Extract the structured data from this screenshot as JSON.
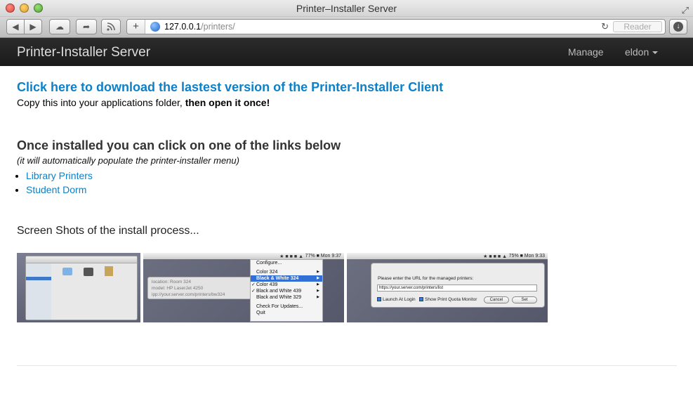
{
  "window": {
    "title": "Printer–Installer Server"
  },
  "browser": {
    "address_host": "127.0.0.1",
    "address_path": "/printers/",
    "reader_label": "Reader",
    "plus_label": "+"
  },
  "navbar": {
    "brand": "Printer-Installer Server",
    "manage": "Manage",
    "user": "eldon"
  },
  "main": {
    "download_link": "Click here to download the lastest version of the Printer-Installer Client",
    "copy_text": "Copy this into your applications folder, ",
    "copy_bold": "then open it once!",
    "installed_heading": "Once installed you can click on one of the links below",
    "installed_note": "(it will automatically populate the printer-installer menu)",
    "links": [
      "Library Printers",
      "Student Dorm"
    ],
    "screenshots_title": "Screen Shots of the install process..."
  },
  "shot2": {
    "menubar_time": "77% ■  Mon 9:37",
    "info_location": "location: Room 324",
    "info_model": "model: HP LaserJet 4250",
    "info_ipp": "ipp://your.server.com/printers/bw324",
    "menu": [
      "Configure...",
      "Color 324",
      "Black & White 324",
      "Color 439",
      "Black and White 439",
      "Black and White 329",
      "Check For Updates...",
      "Quit"
    ]
  },
  "shot3": {
    "menubar_time": "75% ■  Mon 9:33",
    "prompt": "Please enter the URL for the managed printers:",
    "url_value": "https://your.server.com/printers/list",
    "launch_label": "Launch At Login",
    "quota_label": "Show Print Quota Monitor",
    "cancel": "Cancel",
    "set": "Set"
  },
  "colors": {
    "link": "#0d80c8",
    "navbar": "#1f1f1f"
  }
}
